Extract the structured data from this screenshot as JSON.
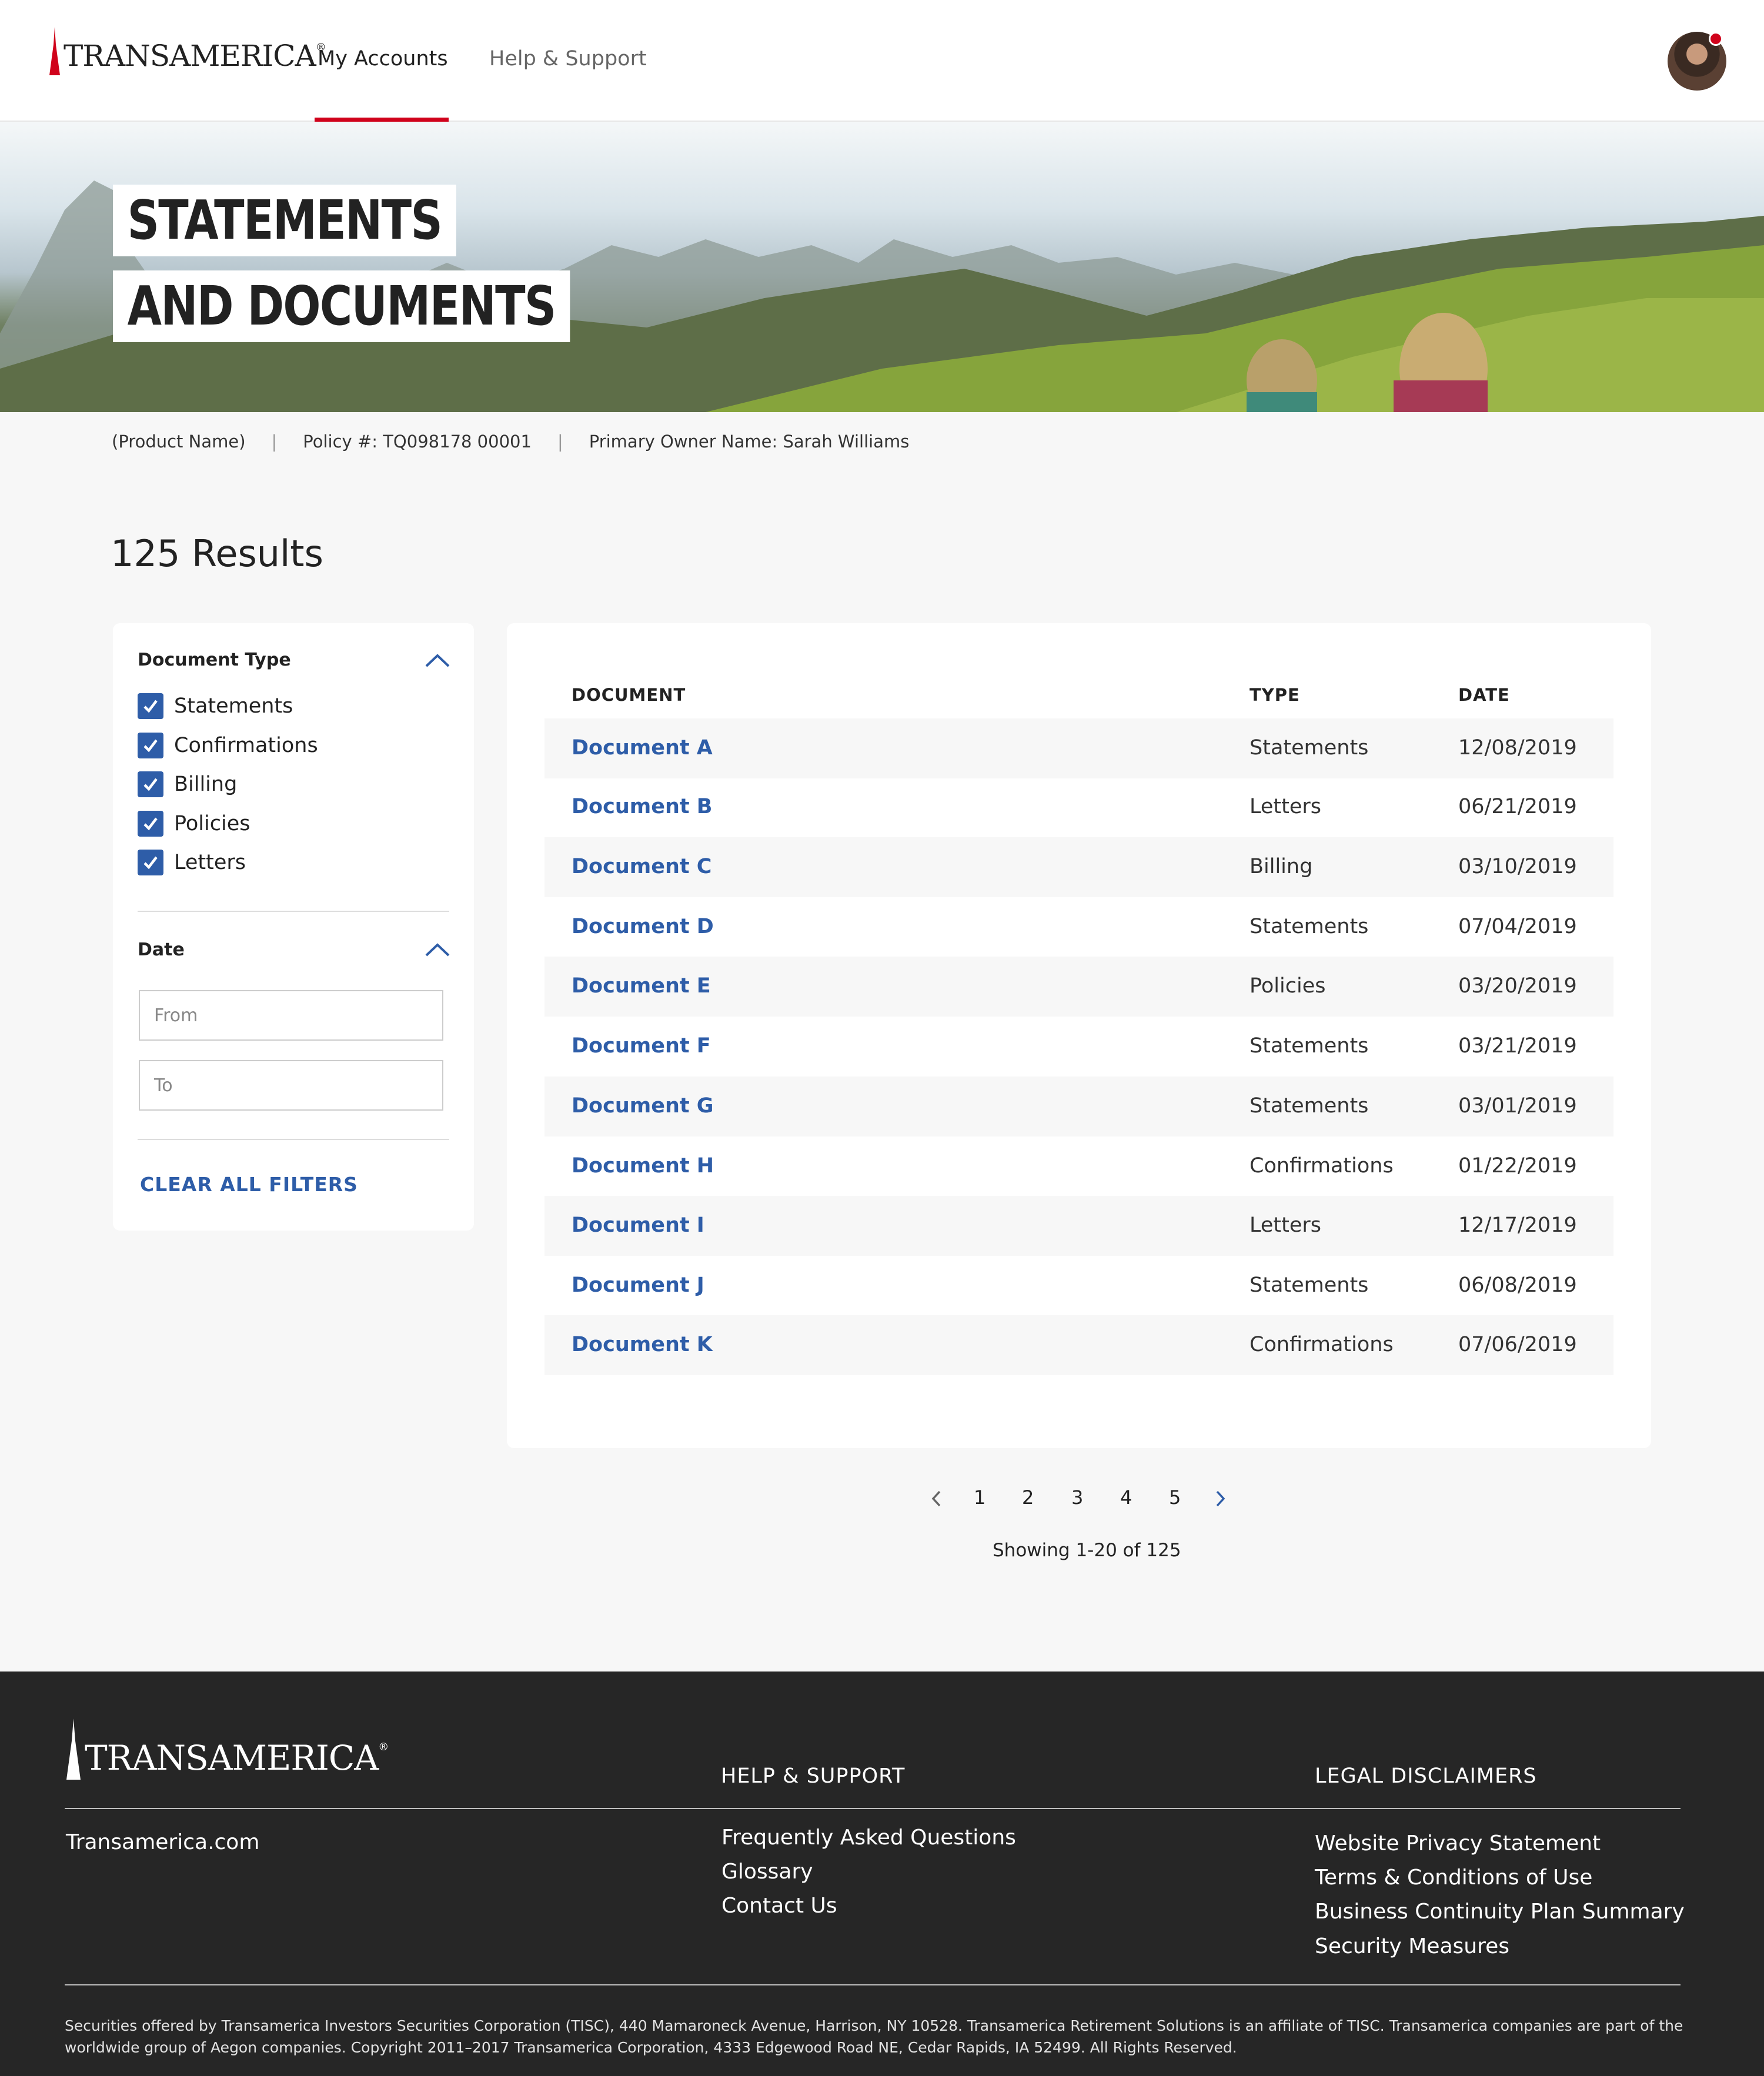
{
  "header": {
    "brand": "TRANSAMERICA",
    "nav": [
      {
        "label": "My Accounts",
        "active": true
      },
      {
        "label": "Help & Support",
        "active": false
      }
    ],
    "accent_color": "#d0021b"
  },
  "hero": {
    "title_line1": "STATEMENTS",
    "title_line2": "AND DOCUMENTS"
  },
  "info": {
    "product": "(Product Name)",
    "policy": "Policy #: TQ098178 00001",
    "owner": "Primary Owner Name: Sarah Williams"
  },
  "results": {
    "title": "125 Results"
  },
  "filters": {
    "doc_type_heading": "Document Type",
    "doc_types": [
      {
        "label": "Statements",
        "checked": true
      },
      {
        "label": "Confirmations",
        "checked": true
      },
      {
        "label": "Billing",
        "checked": true
      },
      {
        "label": "Policies",
        "checked": true
      },
      {
        "label": "Letters",
        "checked": true
      }
    ],
    "date_heading": "Date",
    "from_placeholder": "From",
    "to_placeholder": "To",
    "clear_label": "CLEAR ALL FILTERS"
  },
  "table": {
    "headers": [
      "DOCUMENT",
      "TYPE",
      "DATE"
    ],
    "rows": [
      {
        "document": "Document A",
        "type": "Statements",
        "date": "12/08/2019"
      },
      {
        "document": "Document B",
        "type": "Letters",
        "date": "06/21/2019"
      },
      {
        "document": "Document C",
        "type": "Billing",
        "date": "03/10/2019"
      },
      {
        "document": "Document D",
        "type": "Statements",
        "date": "07/04/2019"
      },
      {
        "document": "Document E",
        "type": "Policies",
        "date": "03/20/2019"
      },
      {
        "document": "Document F",
        "type": "Statements",
        "date": "03/21/2019"
      },
      {
        "document": "Document G",
        "type": "Statements",
        "date": "03/01/2019"
      },
      {
        "document": "Document H",
        "type": "Confirmations",
        "date": "01/22/2019"
      },
      {
        "document": "Document I",
        "type": "Letters",
        "date": "12/17/2019"
      },
      {
        "document": "Document J",
        "type": "Statements",
        "date": "06/08/2019"
      },
      {
        "document": "Document K",
        "type": "Confirmations",
        "date": "07/06/2019"
      }
    ],
    "link_color": "#2e5da8"
  },
  "pagination": {
    "pages": [
      "1",
      "2",
      "3",
      "4",
      "5"
    ],
    "showing": "Showing 1-20 of 125"
  },
  "footer": {
    "brand": "TRANSAMERICA",
    "site_link": "Transamerica.com",
    "help_heading": "HELP & SUPPORT",
    "help_links": [
      "Frequently Asked Questions",
      "Glossary",
      "Contact Us"
    ],
    "legal_heading": "LEGAL DISCLAIMERS",
    "legal_links": [
      "Website Privacy Statement",
      "Terms & Conditions of Use",
      "Business Continuity Plan Summary",
      "Security Measures"
    ],
    "legal_text": "Securities offered by Transamerica Investors Securities Corporation (TISC), 440 Mamaroneck Avenue, Harrison, NY 10528. Transamerica Retirement Solutions is an affiliate of TISC. Transamerica companies are part of the worldwide group of Aegon companies. Copyright 2011–2017 Transamerica Corporation, 4333 Edgewood Road NE, Cedar Rapids, IA 52499. All Rights Reserved."
  }
}
